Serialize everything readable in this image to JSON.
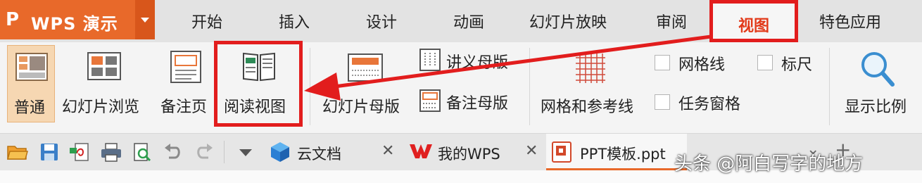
{
  "app": {
    "logo_mark": "P",
    "logo_text": "WPS 演示"
  },
  "menu_tabs": [
    "开始",
    "插入",
    "设计",
    "动画",
    "幻灯片放映",
    "审阅",
    "视图",
    "特色应用"
  ],
  "active_tab": "视图",
  "ribbon": {
    "views": [
      "普通",
      "幻灯片浏览",
      "备注页",
      "阅读视图"
    ],
    "masters": {
      "slide_master": "幻灯片母版",
      "handout_master": "讲义母版",
      "notes_master": "备注母版"
    },
    "grid": {
      "grid_guides": "网格和参考线"
    },
    "checkboxes": {
      "gridlines": "网格线",
      "ruler": "标尺",
      "task_pane": "任务窗格"
    },
    "zoom": "显示比例"
  },
  "doc_tabs": [
    {
      "title": "云文档"
    },
    {
      "title": "我的WPS"
    },
    {
      "title": "PPT模板.ppt"
    }
  ],
  "watermark": "头条 @阿白写字的地方",
  "colors": {
    "accent": "#e8692a",
    "highlight": "#e21d1d",
    "active_tab_text": "#e23a1a"
  }
}
